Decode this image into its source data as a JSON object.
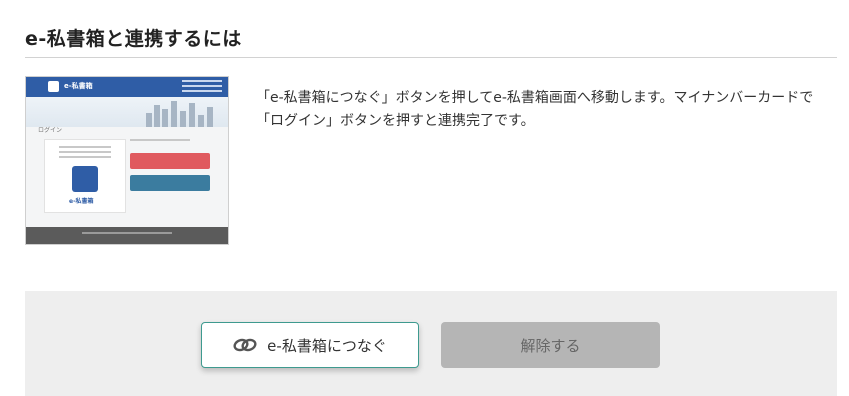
{
  "section": {
    "title": "e-私書箱と連携するには"
  },
  "thumbnail": {
    "logo_text": "e-私書箱",
    "login_label": "ログイン",
    "box_label": "e-私書箱"
  },
  "description": "「e-私書箱につなぐ」ボタンを押してe-私書箱画面へ移動します。マイナンバーカードで「ログイン」ボタンを押すと連携完了です。",
  "actions": {
    "connect_label": "e-私書箱につなぐ",
    "unlink_label": "解除する"
  },
  "colors": {
    "connect_border": "#3e9a8f",
    "panel_background": "#eeeeee",
    "unlink_background": "#b5b5b5"
  }
}
